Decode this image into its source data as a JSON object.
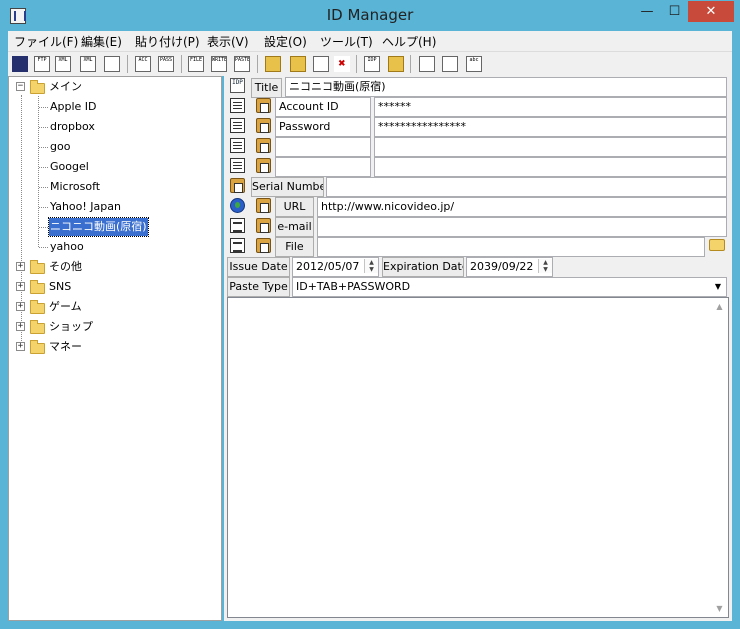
{
  "window": {
    "title": "ID Manager"
  },
  "menu": [
    "ファイル(F)",
    "編集(E)",
    "貼り付け(P)",
    "表示(V)",
    "設定(O)",
    "ツール(T)",
    "ヘルプ(H)"
  ],
  "toolbar": {
    "buttons": [
      {
        "name": "save-icon",
        "text": ""
      },
      {
        "name": "ftp-icon",
        "text": "FTP"
      },
      {
        "name": "xml-import-icon",
        "text": "XML"
      },
      {
        "name": "xml-export-icon",
        "text": "XML"
      },
      {
        "name": "print-icon",
        "text": ""
      },
      {
        "name": "copy-account-icon",
        "text": "ACC"
      },
      {
        "name": "copy-password-icon",
        "text": "PASS"
      },
      {
        "name": "file-icon",
        "text": "FILE"
      },
      {
        "name": "write-icon",
        "text": "WRITE"
      },
      {
        "name": "paste-icon",
        "text": "PASTE"
      },
      {
        "name": "new-folder-icon",
        "text": ""
      },
      {
        "name": "new-subfolder-icon",
        "text": ""
      },
      {
        "name": "new-item-icon",
        "text": ""
      },
      {
        "name": "delete-icon",
        "text": "✖"
      },
      {
        "name": "idp-icon",
        "text": "IDP"
      },
      {
        "name": "lock-icon",
        "text": ""
      },
      {
        "name": "window-lock-icon",
        "text": ""
      },
      {
        "name": "window-list-icon",
        "text": ""
      },
      {
        "name": "screen-keyboard-icon",
        "text": "abc"
      }
    ]
  },
  "tree": {
    "root": "メイン",
    "root_children": [
      "Apple ID",
      "dropbox",
      "goo",
      "Googel",
      "Microsoft",
      "Yahoo! Japan",
      "ニコニコ動画(原宿)",
      "yahoo"
    ],
    "selected": "ニコニコ動画(原宿)",
    "folders": [
      "その他",
      "SNS",
      "ゲーム",
      "ショップ",
      "マネー"
    ],
    "expander_collapsed": "+",
    "expander_expanded": "−"
  },
  "detail": {
    "title_label": "Title",
    "title_value": "ニコニコ動画(原宿)",
    "rows": [
      {
        "label": "Account ID",
        "value": "******"
      },
      {
        "label": "Password",
        "value": "****************"
      },
      {
        "label": "",
        "value": ""
      },
      {
        "label": "",
        "value": ""
      }
    ],
    "serial_label": "Serial Numbe",
    "serial_value": "",
    "url_label": "URL",
    "url_value": "http://www.nicovideo.jp/",
    "email_label": "e-mail",
    "email_value": "",
    "file_label": "File",
    "file_value": "",
    "issue_label": "Issue Date",
    "issue_value": "2012/05/07",
    "expiration_label": "Expiration Date",
    "expiration_value": "2039/09/22",
    "paste_type_label": "Paste Type",
    "paste_type_value": "ID+TAB+PASSWORD",
    "notes": ""
  },
  "icons": {
    "id_row": "IDP",
    "field_types": [
      "document-icon",
      "document-icon",
      "document-icon",
      "document-icon"
    ]
  },
  "colors": {
    "window_frame": "#59b4d6",
    "selection": "#3a6fcf",
    "close_button": "#c74a3a"
  }
}
